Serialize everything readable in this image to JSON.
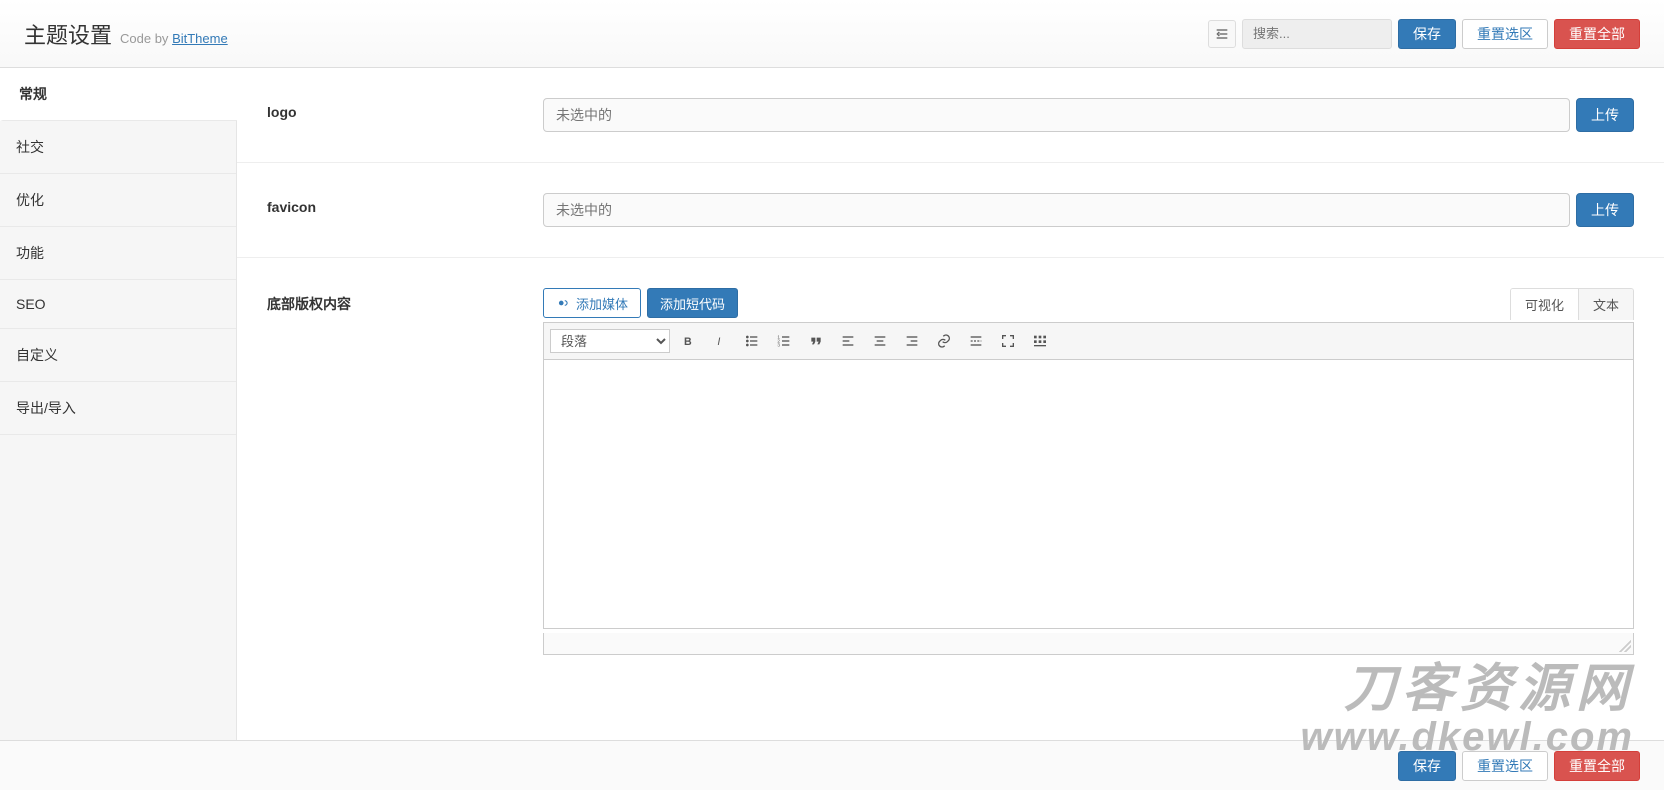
{
  "header": {
    "title": "主题设置",
    "code_by_prefix": "Code by ",
    "code_by_link": "BitTheme",
    "search_placeholder": "搜索...",
    "save_label": "保存",
    "reset_section_label": "重置选区",
    "reset_all_label": "重置全部"
  },
  "sidebar": {
    "items": [
      {
        "label": "常规"
      },
      {
        "label": "社交"
      },
      {
        "label": "优化"
      },
      {
        "label": "功能"
      },
      {
        "label": "SEO"
      },
      {
        "label": "自定义"
      },
      {
        "label": "导出/导入"
      }
    ],
    "active_index": 0
  },
  "fields": {
    "logo_label": "logo",
    "favicon_label": "favicon",
    "footer_label": "底部版权内容",
    "not_selected": "未选中的",
    "upload_label": "上传"
  },
  "editor": {
    "add_media_label": "添加媒体",
    "add_shortcode_label": "添加短代码",
    "tab_visual": "可视化",
    "tab_text": "文本",
    "format_select": "段落"
  },
  "footer": {
    "save_label": "保存",
    "reset_section_label": "重置选区",
    "reset_all_label": "重置全部"
  },
  "watermark": {
    "cn": "刀客资源网",
    "url": "www.dkewl.com"
  }
}
